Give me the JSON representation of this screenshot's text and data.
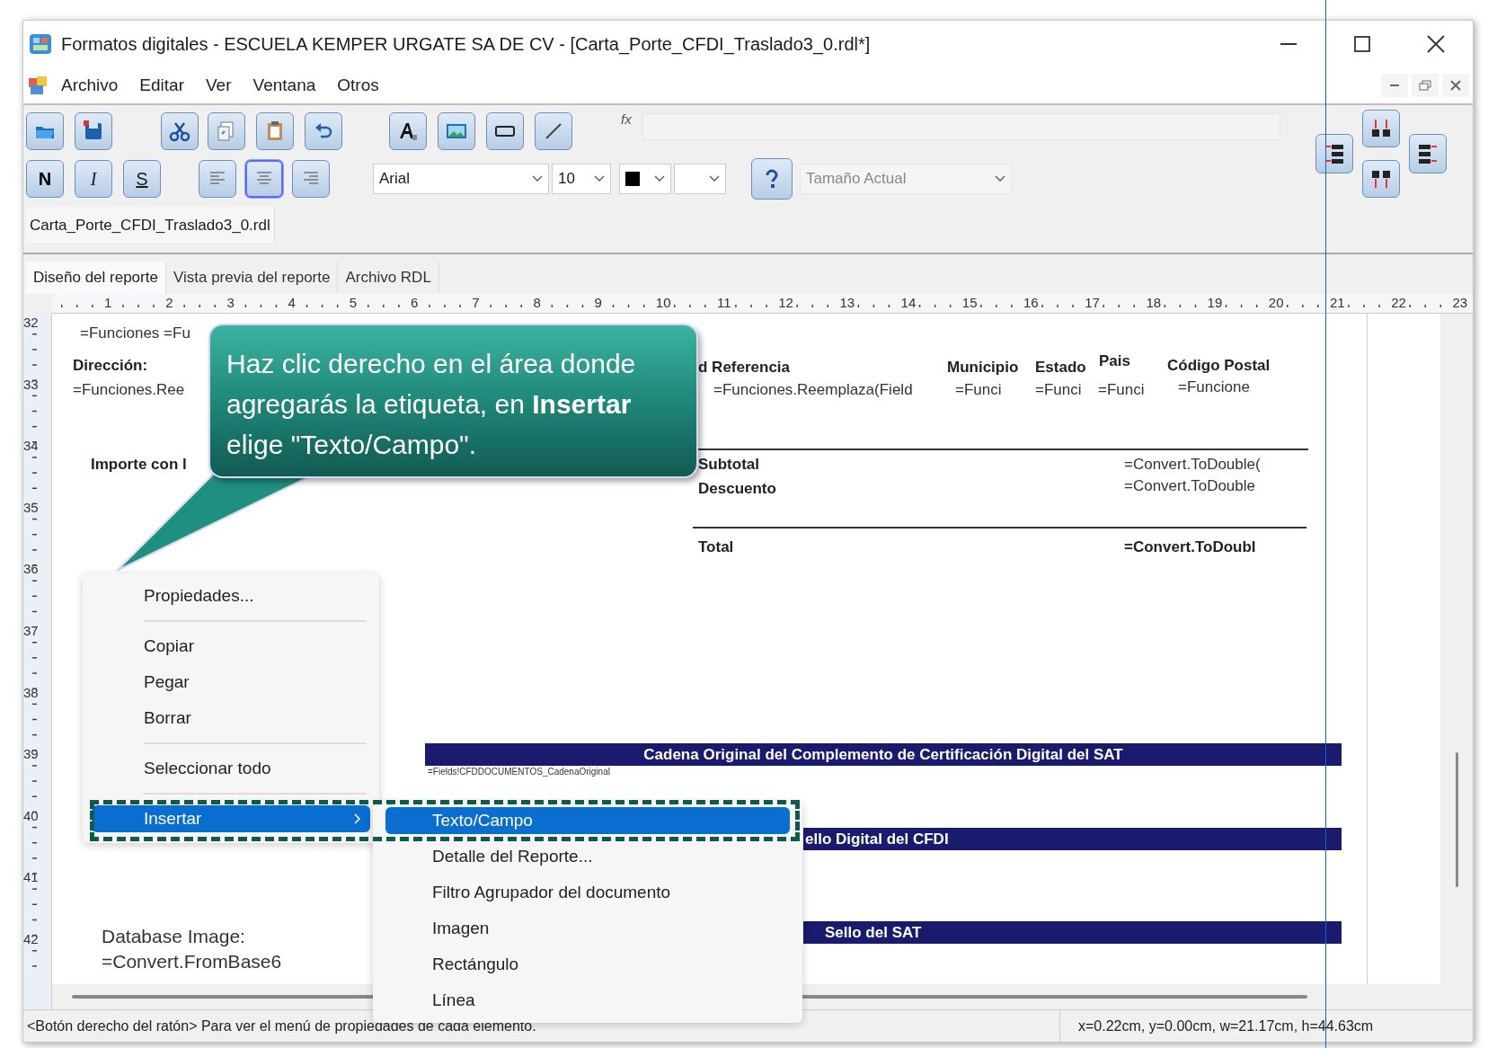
{
  "window": {
    "title": "Formatos digitales - ESCUELA KEMPER URGATE SA DE CV - [Carta_Porte_CFDI_Traslado3_0.rdl*]"
  },
  "menu_bar": [
    "Archivo",
    "Editar",
    "Ver",
    "Ventana",
    "Otros"
  ],
  "toolbar": {
    "style_buttons": [
      "N",
      "I",
      "S"
    ],
    "align_buttons": [
      {
        "kind": "left",
        "selected": false
      },
      {
        "kind": "center",
        "selected": true
      },
      {
        "kind": "right",
        "selected": false
      }
    ],
    "formula_label": "fx",
    "font": "Arial",
    "size": "10",
    "zoom": {
      "value": "Tamaño Actual",
      "disabled": true
    }
  },
  "document_tab": "Carta_Porte_CFDI_Traslado3_0.rdl",
  "tabs": [
    {
      "label": "Diseño del reporte",
      "selected": true
    },
    {
      "label": "Vista previa del reporte",
      "selected": false
    },
    {
      "label": "Archivo RDL",
      "selected": false
    }
  ],
  "ruler": {
    "horizontal": [
      "1",
      "2",
      "3",
      "4",
      "5",
      "6",
      "7",
      "8",
      "9",
      "10",
      "11",
      "12",
      "13",
      "14",
      "15",
      "16",
      "17",
      "18",
      "19",
      "20",
      "21",
      "22",
      "23"
    ],
    "vertical": [
      "32",
      "33",
      "34",
      "35",
      "36",
      "37",
      "38",
      "39",
      "40",
      "41",
      "42"
    ]
  },
  "report": [
    {
      "kind": "value",
      "text": "=Funciones =Fu"
    },
    {
      "kind": "label",
      "text": "Dirección:"
    },
    {
      "kind": "value",
      "text": "=Funciones.Ree"
    },
    {
      "kind": "label",
      "text": "Importe con l"
    },
    {
      "kind": "label",
      "text": "d Referencia"
    },
    {
      "kind": "label",
      "text": "Municipio"
    },
    {
      "kind": "label",
      "text": "Estado"
    },
    {
      "kind": "label",
      "text": "Pais"
    },
    {
      "kind": "label",
      "text": "Código Postal"
    },
    {
      "kind": "value",
      "text": "=Funciones.Reemplaza(Field"
    },
    {
      "kind": "value",
      "text": "=Funci"
    },
    {
      "kind": "value",
      "text": "=Funci"
    },
    {
      "kind": "value",
      "text": "=Funci"
    },
    {
      "kind": "value",
      "text": "=Funcione"
    },
    {
      "kind": "rule"
    },
    {
      "kind": "label",
      "text": "Subtotal"
    },
    {
      "kind": "label",
      "text": "Descuento"
    },
    {
      "kind": "value",
      "text": "=Convert.ToDouble("
    },
    {
      "kind": "value",
      "text": "=Convert.ToDouble"
    },
    {
      "kind": "rule"
    },
    {
      "kind": "label",
      "text": "Total"
    },
    {
      "kind": "label",
      "text": "=Convert.ToDoubl"
    },
    {
      "kind": "band",
      "text": "Cadena Original del Complemento de Certificación Digital del SAT"
    },
    {
      "kind": "small",
      "text": "=Fields!CFDDOCUMENTOS_CadenaOriginal"
    },
    {
      "kind": "band",
      "text": "ello Digital del CFDI"
    },
    {
      "kind": "band",
      "text": "Sello del SAT"
    },
    {
      "kind": "large",
      "text": "Database Image:"
    },
    {
      "kind": "large",
      "text": "=Convert.FromBase6"
    }
  ],
  "callout": {
    "text": "Haz clic derecho en el área donde agregarás la etiqueta, en **Insertar** elige \"Texto/Campo\"."
  },
  "context_menu": [
    {
      "kind": "item",
      "label": "Propiedades...",
      "selected": false
    },
    {
      "kind": "separator"
    },
    {
      "kind": "item",
      "label": "Copiar",
      "selected": false
    },
    {
      "kind": "item",
      "label": "Pegar",
      "selected": false
    },
    {
      "kind": "item",
      "label": "Borrar",
      "selected": false
    },
    {
      "kind": "separator"
    },
    {
      "kind": "item",
      "label": "Seleccionar todo",
      "selected": false
    },
    {
      "kind": "separator"
    },
    {
      "kind": "submenu",
      "label": "Insertar",
      "selected": true
    }
  ],
  "submenu": [
    {
      "label": "Texto/Campo",
      "selected": true
    },
    {
      "label": "Detalle del Reporte...",
      "selected": false
    },
    {
      "label": "Filtro Agrupador del documento",
      "selected": false
    },
    {
      "label": "Imagen",
      "selected": false
    },
    {
      "label": "Rectángulo",
      "selected": false
    },
    {
      "label": "Línea",
      "selected": false
    }
  ],
  "status_bar": {
    "hint": "<Botón derecho del ratón> Para ver el menú de propiedades de cada elemento.",
    "coordinates": "x=0.22cm, y=0.00cm, w=21.17cm, h=44.63cm"
  }
}
